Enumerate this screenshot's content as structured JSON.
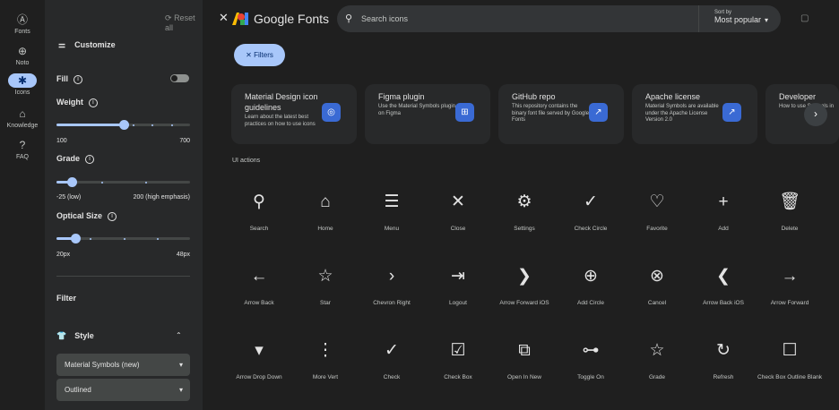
{
  "rail": [
    {
      "label": "Fonts",
      "icon": "font-icon",
      "glyph": "Ⓐ"
    },
    {
      "label": "Noto",
      "icon": "globe-icon",
      "glyph": "⊕"
    },
    {
      "label": "Icons",
      "icon": "icons-icon",
      "glyph": "✱",
      "active": true
    },
    {
      "label": "Knowledge",
      "icon": "graduation-icon",
      "glyph": "⌂"
    },
    {
      "label": "FAQ",
      "icon": "help-icon",
      "glyph": "?"
    }
  ],
  "panel": {
    "reset_label": "Reset all",
    "customize_label": "Customize",
    "fill_label": "Fill",
    "weight_label": "Weight",
    "weight_min": "100",
    "weight_max": "700",
    "weight_value": 400,
    "grade_label": "Grade",
    "grade_min": "-25 (low)",
    "grade_max": "200 (high emphasis)",
    "grade_value": 0,
    "optical_label": "Optical Size",
    "optical_min": "20px",
    "optical_max": "48px",
    "optical_value": 24,
    "filter_label": "Filter",
    "style_label": "Style",
    "style_select": "Material Symbols (new)",
    "variant_select": "Outlined"
  },
  "header": {
    "brand": "Google Fonts",
    "search_placeholder": "Search icons",
    "sort_label": "Sort by",
    "sort_value": "Most popular",
    "filters_label": "Filters"
  },
  "cards": [
    {
      "title": "Material Design icon guidelines",
      "desc": "Learn about the latest best practices on how to use icons",
      "icon": "material-icon",
      "glyph": "◎"
    },
    {
      "title": "Figma plugin",
      "desc": "Use the Material Symbols plugin on Figma",
      "icon": "figma-icon",
      "glyph": "⊞"
    },
    {
      "title": "GitHub repo",
      "desc": "This repository contains the binary font file served by Google Fonts",
      "icon": "external-link-icon",
      "glyph": "↗"
    },
    {
      "title": "Apache license",
      "desc": "Material Symbols are available under the Apache License Version 2.0",
      "icon": "external-link-icon",
      "glyph": "↗"
    },
    {
      "title": "Developer",
      "desc": "How to use Symbols in",
      "icon": "",
      "glyph": ""
    }
  ],
  "section_label": "UI actions",
  "icons": [
    {
      "name": "Search",
      "glyph": "⚲",
      "icon": "search-icon"
    },
    {
      "name": "Home",
      "glyph": "⌂",
      "icon": "home-icon"
    },
    {
      "name": "Menu",
      "glyph": "☰",
      "icon": "menu-icon"
    },
    {
      "name": "Close",
      "glyph": "✕",
      "icon": "close-icon"
    },
    {
      "name": "Settings",
      "glyph": "⚙",
      "icon": "settings-icon"
    },
    {
      "name": "Check Circle",
      "glyph": "✓",
      "icon": "check-circle-icon"
    },
    {
      "name": "Favorite",
      "glyph": "♡",
      "icon": "favorite-icon"
    },
    {
      "name": "Add",
      "glyph": "+",
      "icon": "add-icon"
    },
    {
      "name": "Delete",
      "glyph": "🗑",
      "icon": "delete-icon"
    },
    {
      "name": "Arrow Back",
      "glyph": "←",
      "icon": "arrow-back-icon"
    },
    {
      "name": "Star",
      "glyph": "☆",
      "icon": "star-icon"
    },
    {
      "name": "Chevron Right",
      "glyph": "›",
      "icon": "chevron-right-icon"
    },
    {
      "name": "Logout",
      "glyph": "⇥",
      "icon": "logout-icon"
    },
    {
      "name": "Arrow Forward iOS",
      "glyph": "❯",
      "icon": "arrow-forward-ios-icon"
    },
    {
      "name": "Add Circle",
      "glyph": "⊕",
      "icon": "add-circle-icon"
    },
    {
      "name": "Cancel",
      "glyph": "⊗",
      "icon": "cancel-icon"
    },
    {
      "name": "Arrow Back iOS",
      "glyph": "❮",
      "icon": "arrow-back-ios-icon"
    },
    {
      "name": "Arrow Forward",
      "glyph": "→",
      "icon": "arrow-forward-icon"
    },
    {
      "name": "Arrow Drop Down",
      "glyph": "▾",
      "icon": "arrow-drop-down-icon"
    },
    {
      "name": "More Vert",
      "glyph": "⋮",
      "icon": "more-vert-icon"
    },
    {
      "name": "Check",
      "glyph": "✓",
      "icon": "check-icon"
    },
    {
      "name": "Check Box",
      "glyph": "☑",
      "icon": "check-box-icon"
    },
    {
      "name": "Open In New",
      "glyph": "⧉",
      "icon": "open-in-new-icon"
    },
    {
      "name": "Toggle On",
      "glyph": "⊶",
      "icon": "toggle-on-icon"
    },
    {
      "name": "Grade",
      "glyph": "☆",
      "icon": "grade-icon"
    },
    {
      "name": "Refresh",
      "glyph": "↻",
      "icon": "refresh-icon"
    },
    {
      "name": "Check Box Outline Blank",
      "glyph": "☐",
      "icon": "check-box-outline-blank-icon"
    }
  ],
  "colors": {
    "accent": "#a8c7fa",
    "background": "#1f1f1f",
    "panel": "#28292a"
  }
}
